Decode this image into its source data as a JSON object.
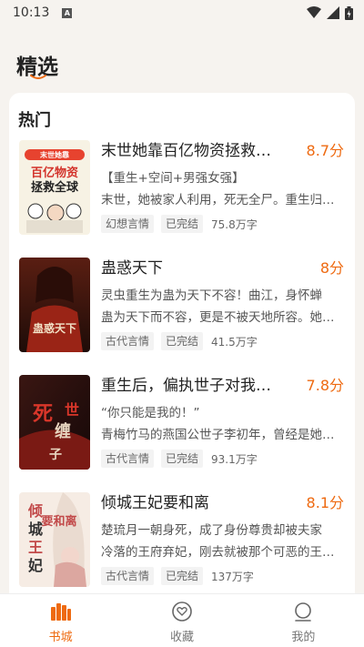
{
  "status": {
    "time": "10:13",
    "a_badge": "A"
  },
  "page": {
    "title": "精选"
  },
  "section": {
    "title": "热门"
  },
  "books": [
    {
      "title": "末世她靠百亿物资拯救全球",
      "score": "8.7分",
      "desc_line1": "【重生+空间+男强女强】",
      "desc_line2": "末世，她被家人利用，死无全尸。重生归来她要让所有人付出代价",
      "tag1": "幻想言情",
      "tag2": "已完结",
      "words": "75.8万字",
      "cover_text": "百亿物资 拯救全球",
      "cover_top": "末世她靠",
      "cover_colors": [
        "#f7f2e4",
        "#e7432f"
      ]
    },
    {
      "title": "蛊惑天下",
      "score": "8分",
      "desc_line1": "灵虫重生为蛊为天下不容！曲江，身怀蝉",
      "desc_line2": "蛊为天下而不容，更是不被天地所容。她只能一路逆天而行",
      "tag1": "古代言情",
      "tag2": "已完结",
      "words": "41.5万字",
      "cover_text": "蛊惑天下",
      "cover_top": "",
      "cover_colors": [
        "#3a1a14",
        "#b8321f"
      ]
    },
    {
      "title": "重生后，偏执世子对我蓄谋已久",
      "score": "7.8分",
      "desc_line1": "“你只能是我的！”",
      "desc_line2": "青梅竹马的燕国公世子李初年，曾经是她最信任的人",
      "tag1": "古代言情",
      "tag2": "已完结",
      "words": "93.1万字",
      "cover_text": "死缠世子",
      "cover_top": "",
      "cover_colors": [
        "#241010",
        "#a3261c"
      ]
    },
    {
      "title": "倾城王妃要和离",
      "score": "8.1分",
      "desc_line1": "楚琉月一朝身死，成了身份尊贵却被夫家",
      "desc_line2": "冷落的王府弃妃，刚去就被那个可恶的王爷赶出府",
      "tag1": "古代言情",
      "tag2": "已完结",
      "words": "137万字",
      "cover_text": "倾城王妃 要和离",
      "cover_top": "",
      "cover_colors": [
        "#f6ece4",
        "#c24a4a"
      ]
    }
  ],
  "tabs": [
    {
      "label": "书城",
      "icon": "bookstore-icon",
      "active": true
    },
    {
      "label": "收藏",
      "icon": "heart-icon",
      "active": false
    },
    {
      "label": "我的",
      "icon": "profile-icon",
      "active": false
    }
  ],
  "colors": {
    "accent": "#ee6a11",
    "background": "#f6f3ef"
  }
}
